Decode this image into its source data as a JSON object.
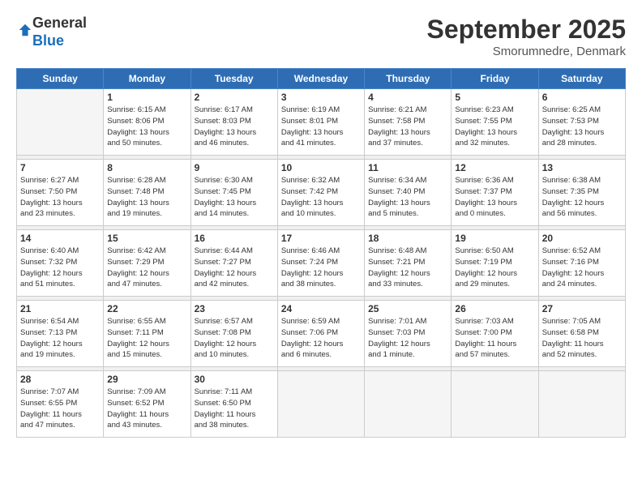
{
  "header": {
    "logo_line1": "General",
    "logo_line2": "Blue",
    "month": "September 2025",
    "location": "Smorumnedre, Denmark"
  },
  "weekdays": [
    "Sunday",
    "Monday",
    "Tuesday",
    "Wednesday",
    "Thursday",
    "Friday",
    "Saturday"
  ],
  "weeks": [
    [
      {
        "day": "",
        "info": ""
      },
      {
        "day": "1",
        "info": "Sunrise: 6:15 AM\nSunset: 8:06 PM\nDaylight: 13 hours\nand 50 minutes."
      },
      {
        "day": "2",
        "info": "Sunrise: 6:17 AM\nSunset: 8:03 PM\nDaylight: 13 hours\nand 46 minutes."
      },
      {
        "day": "3",
        "info": "Sunrise: 6:19 AM\nSunset: 8:01 PM\nDaylight: 13 hours\nand 41 minutes."
      },
      {
        "day": "4",
        "info": "Sunrise: 6:21 AM\nSunset: 7:58 PM\nDaylight: 13 hours\nand 37 minutes."
      },
      {
        "day": "5",
        "info": "Sunrise: 6:23 AM\nSunset: 7:55 PM\nDaylight: 13 hours\nand 32 minutes."
      },
      {
        "day": "6",
        "info": "Sunrise: 6:25 AM\nSunset: 7:53 PM\nDaylight: 13 hours\nand 28 minutes."
      }
    ],
    [
      {
        "day": "7",
        "info": "Sunrise: 6:27 AM\nSunset: 7:50 PM\nDaylight: 13 hours\nand 23 minutes."
      },
      {
        "day": "8",
        "info": "Sunrise: 6:28 AM\nSunset: 7:48 PM\nDaylight: 13 hours\nand 19 minutes."
      },
      {
        "day": "9",
        "info": "Sunrise: 6:30 AM\nSunset: 7:45 PM\nDaylight: 13 hours\nand 14 minutes."
      },
      {
        "day": "10",
        "info": "Sunrise: 6:32 AM\nSunset: 7:42 PM\nDaylight: 13 hours\nand 10 minutes."
      },
      {
        "day": "11",
        "info": "Sunrise: 6:34 AM\nSunset: 7:40 PM\nDaylight: 13 hours\nand 5 minutes."
      },
      {
        "day": "12",
        "info": "Sunrise: 6:36 AM\nSunset: 7:37 PM\nDaylight: 13 hours\nand 0 minutes."
      },
      {
        "day": "13",
        "info": "Sunrise: 6:38 AM\nSunset: 7:35 PM\nDaylight: 12 hours\nand 56 minutes."
      }
    ],
    [
      {
        "day": "14",
        "info": "Sunrise: 6:40 AM\nSunset: 7:32 PM\nDaylight: 12 hours\nand 51 minutes."
      },
      {
        "day": "15",
        "info": "Sunrise: 6:42 AM\nSunset: 7:29 PM\nDaylight: 12 hours\nand 47 minutes."
      },
      {
        "day": "16",
        "info": "Sunrise: 6:44 AM\nSunset: 7:27 PM\nDaylight: 12 hours\nand 42 minutes."
      },
      {
        "day": "17",
        "info": "Sunrise: 6:46 AM\nSunset: 7:24 PM\nDaylight: 12 hours\nand 38 minutes."
      },
      {
        "day": "18",
        "info": "Sunrise: 6:48 AM\nSunset: 7:21 PM\nDaylight: 12 hours\nand 33 minutes."
      },
      {
        "day": "19",
        "info": "Sunrise: 6:50 AM\nSunset: 7:19 PM\nDaylight: 12 hours\nand 29 minutes."
      },
      {
        "day": "20",
        "info": "Sunrise: 6:52 AM\nSunset: 7:16 PM\nDaylight: 12 hours\nand 24 minutes."
      }
    ],
    [
      {
        "day": "21",
        "info": "Sunrise: 6:54 AM\nSunset: 7:13 PM\nDaylight: 12 hours\nand 19 minutes."
      },
      {
        "day": "22",
        "info": "Sunrise: 6:55 AM\nSunset: 7:11 PM\nDaylight: 12 hours\nand 15 minutes."
      },
      {
        "day": "23",
        "info": "Sunrise: 6:57 AM\nSunset: 7:08 PM\nDaylight: 12 hours\nand 10 minutes."
      },
      {
        "day": "24",
        "info": "Sunrise: 6:59 AM\nSunset: 7:06 PM\nDaylight: 12 hours\nand 6 minutes."
      },
      {
        "day": "25",
        "info": "Sunrise: 7:01 AM\nSunset: 7:03 PM\nDaylight: 12 hours\nand 1 minute."
      },
      {
        "day": "26",
        "info": "Sunrise: 7:03 AM\nSunset: 7:00 PM\nDaylight: 11 hours\nand 57 minutes."
      },
      {
        "day": "27",
        "info": "Sunrise: 7:05 AM\nSunset: 6:58 PM\nDaylight: 11 hours\nand 52 minutes."
      }
    ],
    [
      {
        "day": "28",
        "info": "Sunrise: 7:07 AM\nSunset: 6:55 PM\nDaylight: 11 hours\nand 47 minutes."
      },
      {
        "day": "29",
        "info": "Sunrise: 7:09 AM\nSunset: 6:52 PM\nDaylight: 11 hours\nand 43 minutes."
      },
      {
        "day": "30",
        "info": "Sunrise: 7:11 AM\nSunset: 6:50 PM\nDaylight: 11 hours\nand 38 minutes."
      },
      {
        "day": "",
        "info": ""
      },
      {
        "day": "",
        "info": ""
      },
      {
        "day": "",
        "info": ""
      },
      {
        "day": "",
        "info": ""
      }
    ]
  ]
}
